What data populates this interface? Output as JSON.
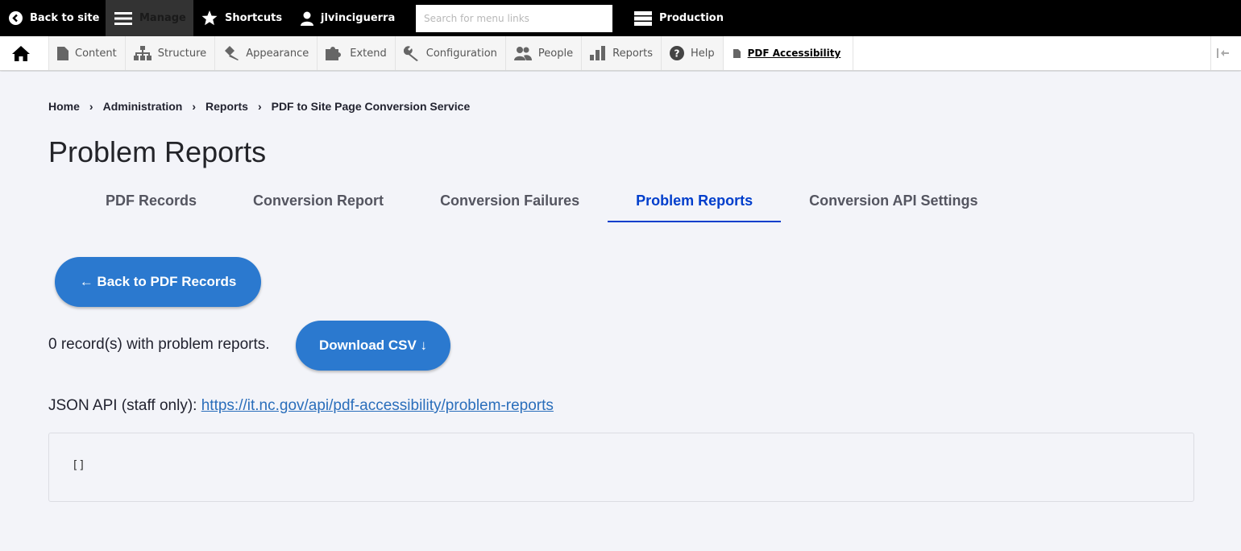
{
  "toolbar": {
    "back_label": "Back to site",
    "manage_label": "Manage",
    "shortcuts_label": "Shortcuts",
    "user_label": "jlvinciguerra",
    "search_placeholder": "Search for menu links",
    "environment_label": "Production"
  },
  "tray": {
    "items": [
      {
        "label": "Content",
        "icon": "file-icon"
      },
      {
        "label": "Structure",
        "icon": "sitemap-icon"
      },
      {
        "label": "Appearance",
        "icon": "paintbrush-icon"
      },
      {
        "label": "Extend",
        "icon": "puzzle-icon"
      },
      {
        "label": "Configuration",
        "icon": "wrench-icon"
      },
      {
        "label": "People",
        "icon": "people-icon"
      },
      {
        "label": "Reports",
        "icon": "bar-chart-icon"
      },
      {
        "label": "Help",
        "icon": "question-icon"
      }
    ],
    "pdf_label": "PDF Accessibility"
  },
  "breadcrumb": [
    "Home",
    "Administration",
    "Reports",
    "PDF to Site Page Conversion Service"
  ],
  "breadcrumb_separator": "›",
  "page_title": "Problem Reports",
  "tabs": [
    {
      "label": "PDF Records"
    },
    {
      "label": "Conversion Report"
    },
    {
      "label": "Conversion Failures"
    },
    {
      "label": "Problem Reports",
      "active": true
    },
    {
      "label": "Conversion API Settings"
    }
  ],
  "content": {
    "back_button": "← Back to PDF Records",
    "record_count_text": "0 record(s) with problem reports.",
    "download_button": "Download CSV ↓",
    "api_label": "JSON API (staff only): ",
    "api_link": "https://it.nc.gov/api/pdf-accessibility/problem-reports",
    "json_output": "[]"
  },
  "colors": {
    "accent": "#003ecc",
    "button": "#2b79cf",
    "toolbar": "#000000",
    "link": "#2a6ebb"
  }
}
